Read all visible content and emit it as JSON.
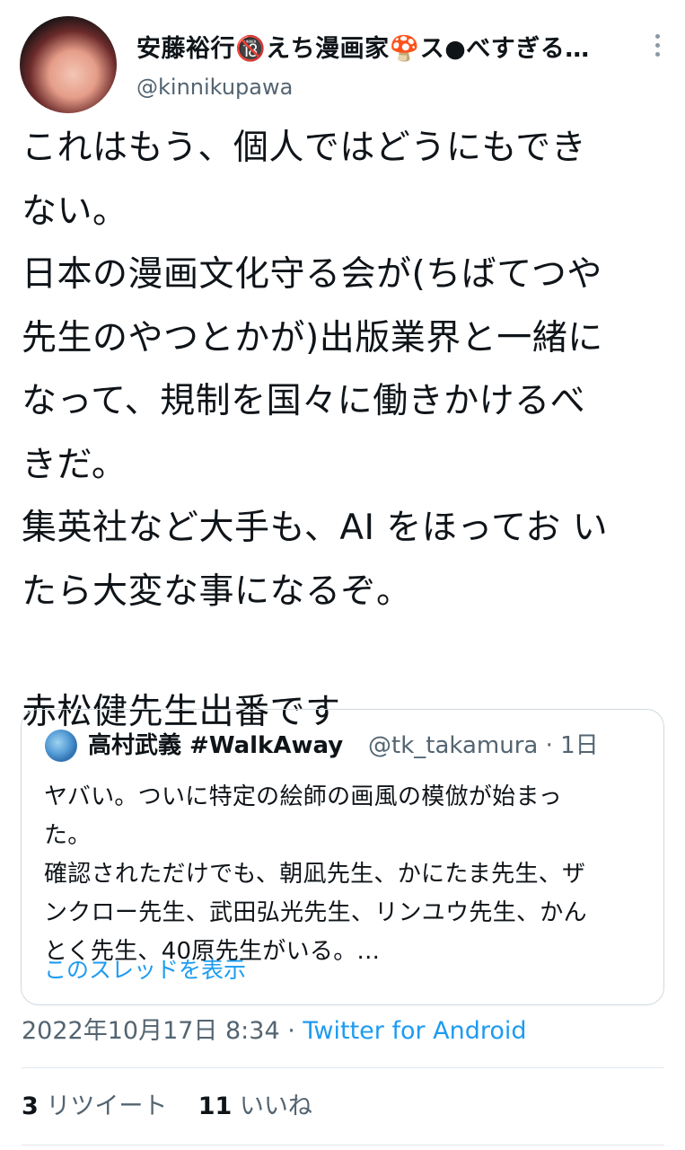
{
  "tweet": {
    "author": {
      "display_name": "安藤裕行🔞えち漫画家🍄ス●べすぎる…",
      "handle": "@kinnikupawa"
    },
    "text_lines": [
      "これはもう、個人ではどうにもでき",
      "ない。",
      "日本の漫画文化守る会が(ちばてつや",
      "先生のやつとかが)出版業界と一緒に",
      "なって、規制を国々に働きかけるべ",
      "きだ。",
      "集英社など大手も、AI をほってお い",
      "たら大変な事になるぞ。",
      "",
      "赤松健先生出番です"
    ],
    "quote": {
      "display_name": "高村武義 #WalkAway",
      "handle_time": "@tk_takamura · 1日",
      "text_lines": [
        "ヤバい。ついに特定の絵師の画風の模倣が始まっ",
        "た。",
        "確認されただけでも、朝凪先生、かにたま先生、ザ",
        "ンクロー先生、武田弘光先生、リンユウ先生、かん",
        "とく先生、40原先生がいる。..."
      ],
      "show_thread": "このスレッドを表示"
    },
    "timestamp": "2022年10月17日 8:34 · ",
    "source": "Twitter for Android",
    "retweets": {
      "count": "3",
      "label": "リツイート"
    },
    "likes": {
      "count": "11",
      "label": "いいね"
    }
  },
  "colors": {
    "text": "#0f1419",
    "secondary": "#536471",
    "link": "#1d9bf0",
    "border": "#cfd9de"
  },
  "icons": {
    "more": "more-vertical-icon"
  }
}
